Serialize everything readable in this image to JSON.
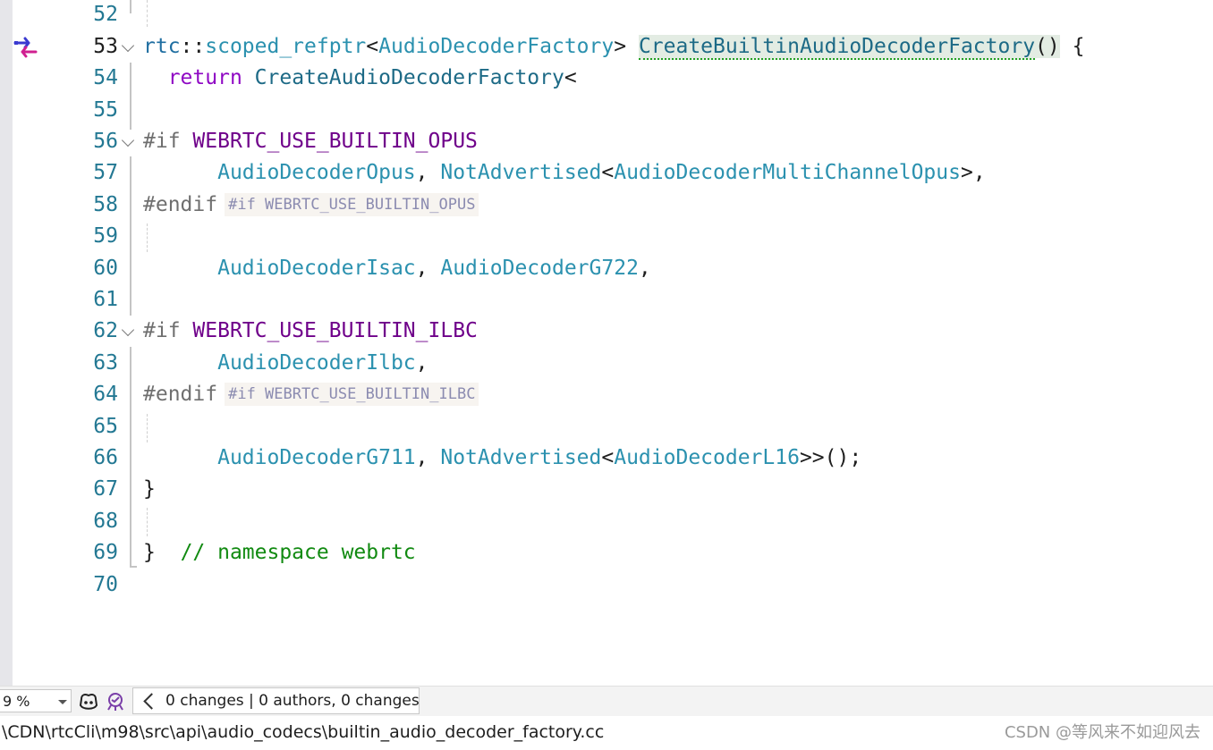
{
  "editor": {
    "lines": [
      {
        "no": "52"
      },
      {
        "no": "53",
        "t1": "rtc",
        "t2": "::",
        "t3": "scoped_refptr",
        "t4": "<",
        "t5": "AudioDecoderFactory",
        "t6": "> ",
        "t7": "CreateBuiltinAudioDecoderFactory",
        "t8": "()",
        "t9": " {"
      },
      {
        "no": "54",
        "t1": "  ",
        "t2": "return",
        "t3": " ",
        "t4": "CreateAudioDecoderFactory",
        "t5": "<"
      },
      {
        "no": "55"
      },
      {
        "no": "56",
        "t1": "#if",
        "t2": " ",
        "t3": "WEBRTC_USE_BUILTIN_OPUS"
      },
      {
        "no": "57",
        "t1": "      ",
        "t2": "AudioDecoderOpus",
        "t3": ", ",
        "t4": "NotAdvertised",
        "t5": "<",
        "t6": "AudioDecoderMultiChannelOpus",
        "t7": ">,"
      },
      {
        "no": "58",
        "t1": "#endif",
        "hint": "#if WEBRTC_USE_BUILTIN_OPUS"
      },
      {
        "no": "59"
      },
      {
        "no": "60",
        "t1": "      ",
        "t2": "AudioDecoderIsac",
        "t3": ", ",
        "t4": "AudioDecoderG722",
        "t5": ","
      },
      {
        "no": "61"
      },
      {
        "no": "62",
        "t1": "#if",
        "t2": " ",
        "t3": "WEBRTC_USE_BUILTIN_ILBC"
      },
      {
        "no": "63",
        "t1": "      ",
        "t2": "AudioDecoderIlbc",
        "t3": ","
      },
      {
        "no": "64",
        "t1": "#endif",
        "hint": "#if WEBRTC_USE_BUILTIN_ILBC"
      },
      {
        "no": "65"
      },
      {
        "no": "66",
        "t1": "      ",
        "t2": "AudioDecoderG711",
        "t3": ", ",
        "t4": "NotAdvertised",
        "t5": "<",
        "t6": "AudioDecoderL16",
        "t7": ">>();"
      },
      {
        "no": "67",
        "t1": "}"
      },
      {
        "no": "68"
      },
      {
        "no": "69",
        "t1": "}",
        "t2": "  ",
        "t3": "// namespace webrtc"
      },
      {
        "no": "70"
      }
    ]
  },
  "status_bar": {
    "zoom": "9 %",
    "changes": "0 changes | 0 authors, 0 changes"
  },
  "path_bar": {
    "path": "\\CDN\\rtcCli\\m98\\src\\api\\audio_codecs\\builtin_audio_decoder_factory.cc",
    "watermark": "CSDN @等风来不如迎风去"
  },
  "colors": {
    "line_number": "#237893",
    "type": "#2b91af",
    "keyword": "#8f08c4",
    "macro": "#6f008a",
    "comment": "#118a11",
    "highlight": "#e3ece3"
  },
  "icons": {
    "bookmark": "quick-action-arrows-icon",
    "copilot": "copilot-icon",
    "intellicode": "intellicode-icon",
    "changes_nav": "chevron-left-icon"
  }
}
